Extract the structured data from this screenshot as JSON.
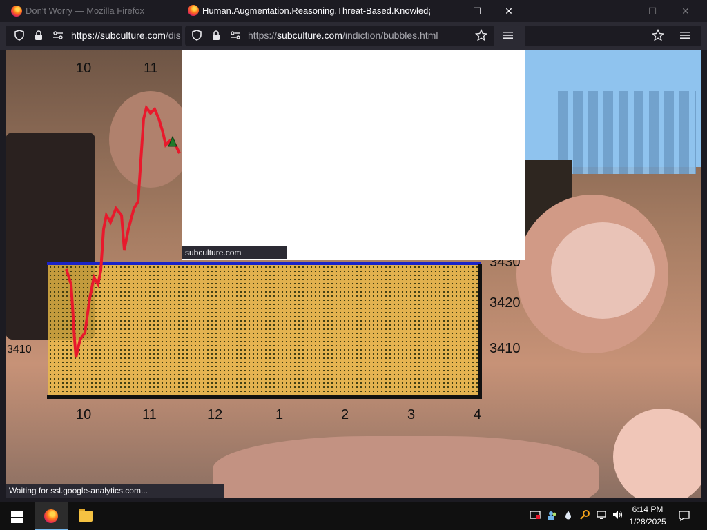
{
  "background_window": {
    "title": "Don't Worry — Mozilla Firefox",
    "url_host": "https://subculture.com",
    "url_path": "/dis",
    "status_text": "Waiting for ssl.google-analytics.com..."
  },
  "popup_window": {
    "title": "Human.Augmentation.Reasoning.Threat-Based.Knowledge....",
    "url_prefix": "https://",
    "url_host": "subculture.com",
    "url_path": "/indiction/bubbles.html",
    "status_text": "subculture.com"
  },
  "window_controls": {
    "minimize": "—",
    "maximize": "☐",
    "close": "✕"
  },
  "chart_overlay": {
    "top_ticks": [
      "10",
      "11"
    ],
    "bottom_ticks": [
      "10",
      "11",
      "12",
      "1",
      "2",
      "3",
      "4"
    ],
    "y_ticks": [
      "3430",
      "3420",
      "3410"
    ],
    "left_tick": "3410"
  },
  "taskbar": {
    "time": "6:14 PM",
    "date": "1/28/2025"
  },
  "colors": {
    "chrome_dark": "#1c1b22",
    "toolbar": "#2b2a33",
    "price_line": "#e8192c",
    "baseline": "#1a23c8"
  }
}
